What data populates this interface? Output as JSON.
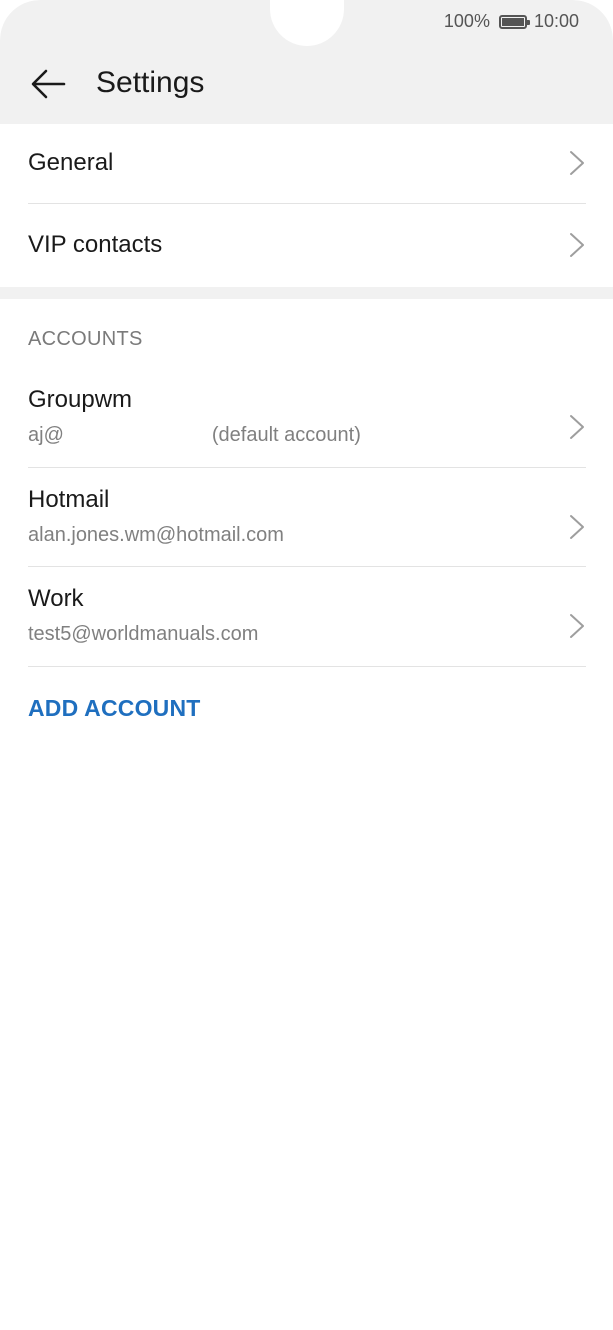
{
  "status_bar": {
    "battery_percent": "100%",
    "time": "10:00",
    "battery_icon": "battery-full-icon"
  },
  "header": {
    "back_icon": "arrow-left-icon",
    "title": "Settings"
  },
  "menu": [
    {
      "label": "General",
      "icon": "chevron-right-icon"
    },
    {
      "label": "VIP contacts",
      "icon": "chevron-right-icon"
    }
  ],
  "accounts_section": {
    "header": "ACCOUNTS",
    "items": [
      {
        "name": "Groupwm",
        "email": "aj@",
        "note": "(default account)"
      },
      {
        "name": "Hotmail",
        "email": "alan.jones.wm@hotmail.com",
        "note": ""
      },
      {
        "name": "Work",
        "email": "test5@worldmanuals.com",
        "note": ""
      }
    ],
    "add_label": "ADD ACCOUNT"
  },
  "colors": {
    "accent": "#1f6fbf",
    "header_bg": "#f1f1f1",
    "text_primary": "#1a1a1a",
    "text_secondary": "#808080"
  }
}
